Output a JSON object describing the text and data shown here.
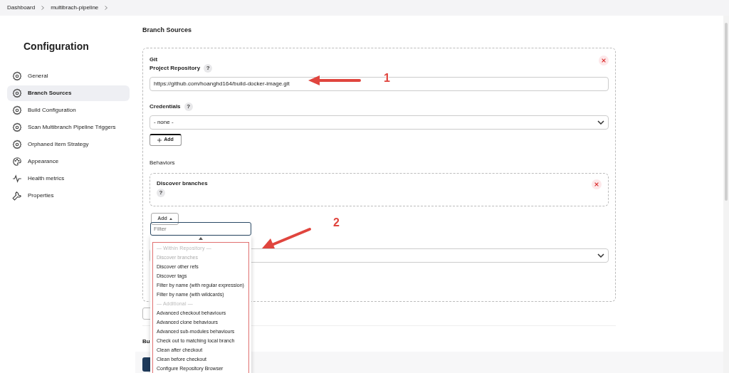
{
  "breadcrumbs": [
    "Dashboard",
    "multibrach-pipeline"
  ],
  "sidebar": {
    "title": "Configuration",
    "items": [
      {
        "label": "General",
        "kind": "gear",
        "selected": false
      },
      {
        "label": "Branch Sources",
        "kind": "gear",
        "selected": true
      },
      {
        "label": "Build Configuration",
        "kind": "gear",
        "selected": false
      },
      {
        "label": "Scan Multibranch Pipeline Triggers",
        "kind": "gear",
        "selected": false
      },
      {
        "label": "Orphaned Item Strategy",
        "kind": "gear",
        "selected": false
      },
      {
        "label": "Appearance",
        "kind": "palette",
        "selected": false
      },
      {
        "label": "Health metrics",
        "kind": "pulse",
        "selected": false
      },
      {
        "label": "Properties",
        "kind": "wrench",
        "selected": false
      }
    ]
  },
  "section": {
    "title": "Branch Sources",
    "source": {
      "title": "Git",
      "repository_label": "Project Repository",
      "repository_value": "https://github.com/hoanghd164/build-docker-image.git",
      "help": "?",
      "credentials_label": "Credentials",
      "credentials_value": "- none -",
      "add_button": "Add",
      "behaviors_label": "Behaviors",
      "behavior": {
        "title": "Discover branches",
        "help": "?"
      },
      "behaviors_add": "Add"
    }
  },
  "next_section_title": "Bu",
  "dropdown": {
    "placeholder": "Filter",
    "items": [
      {
        "kind": "group",
        "label": "— Within Repository —",
        "disabled": true
      },
      {
        "kind": "option",
        "label": "Discover branches",
        "disabled": true
      },
      {
        "kind": "option",
        "label": "Discover other refs",
        "disabled": false
      },
      {
        "kind": "option",
        "label": "Discover tags",
        "disabled": false
      },
      {
        "kind": "option",
        "label": "Filter by name (with regular expression)",
        "disabled": false
      },
      {
        "kind": "option",
        "label": "Filter by name (with wildcards)",
        "disabled": false
      },
      {
        "kind": "group",
        "label": "— Additional —",
        "disabled": true
      },
      {
        "kind": "option",
        "label": "Advanced checkout behaviours",
        "disabled": false
      },
      {
        "kind": "option",
        "label": "Advanced clone behaviours",
        "disabled": false
      },
      {
        "kind": "option",
        "label": "Advanced sub-modules behaviours",
        "disabled": false
      },
      {
        "kind": "option",
        "label": "Check out to matching local branch",
        "disabled": false
      },
      {
        "kind": "option",
        "label": "Clean after checkout",
        "disabled": false
      },
      {
        "kind": "option",
        "label": "Clean before checkout",
        "disabled": false
      },
      {
        "kind": "option",
        "label": "Configure Repository Browser",
        "disabled": false
      }
    ]
  },
  "annotations": [
    "1",
    "2"
  ]
}
